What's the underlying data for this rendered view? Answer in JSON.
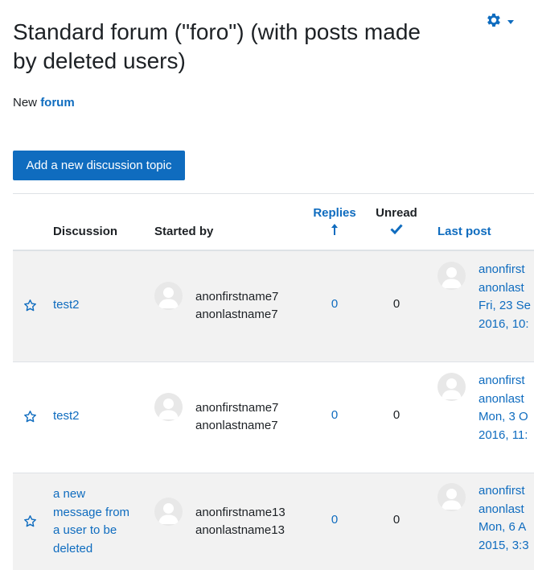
{
  "page": {
    "title": "Standard forum (\"foro\") (with posts made by deleted users)",
    "intro_prefix": "New",
    "intro_link": "forum",
    "add_button": "Add a new discussion topic"
  },
  "icons": {
    "settings": "gear-icon",
    "star": "star-outline-icon",
    "sort": "arrow-up-icon",
    "unread": "checkmark-icon",
    "avatar": "default-user-icon"
  },
  "colors": {
    "accent": "#0f6cbf",
    "row_shade": "#f2f2f2",
    "text": "#1d2125"
  },
  "table": {
    "headers": {
      "discussion": "Discussion",
      "started_by": "Started by",
      "replies": "Replies",
      "unread": "Unread",
      "last_post": "Last post"
    },
    "rows": [
      {
        "title_lines": [
          "test2"
        ],
        "author_first": "anonfirstname7",
        "author_last": "anonlastname7",
        "replies": "0",
        "unread": "0",
        "last_lines": [
          "anonfirst",
          "anonlast",
          "Fri, 23 Se",
          "2016, 10:"
        ]
      },
      {
        "title_lines": [
          "test2"
        ],
        "author_first": "anonfirstname7",
        "author_last": "anonlastname7",
        "replies": "0",
        "unread": "0",
        "last_lines": [
          "anonfirst",
          "anonlast",
          "Mon, 3 O",
          "2016, 11:"
        ]
      },
      {
        "title_lines": [
          "a new",
          "message from",
          "a user to be",
          "deleted"
        ],
        "author_first": "anonfirstname13",
        "author_last": "anonlastname13",
        "replies": "0",
        "unread": "0",
        "last_lines": [
          "anonfirst",
          "anonlast",
          "Mon, 6 A",
          "2015, 3:3"
        ]
      }
    ]
  }
}
